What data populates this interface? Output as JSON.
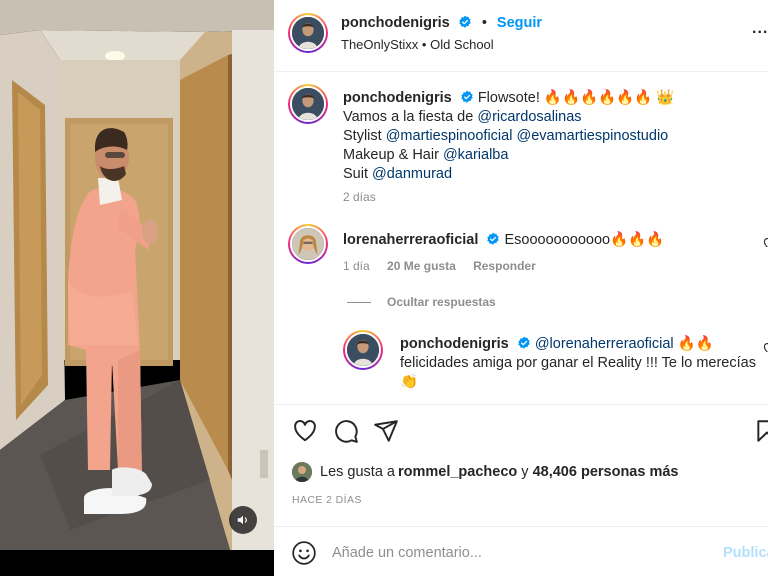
{
  "post": {
    "author": "ponchodenigris",
    "dot": "•",
    "follow_label": "Seguir",
    "audio": "TheOnlyStixx • Old School",
    "more_label": "..."
  },
  "caption": {
    "username": "ponchodenigris",
    "text": "Flowsote!",
    "emoji": "🔥🔥🔥🔥🔥🔥 👑",
    "line2_prefix": "Vamos a la fiesta de ",
    "line2_mention": "@ricardosalinas",
    "line3_prefix": "Stylist ",
    "line3_mention1": "@martiespinooficial",
    "line3_mention2": "@evamartiespinostudio",
    "line4_prefix": "Makeup & Hair ",
    "line4_mention": "@karialba",
    "line5_prefix": "Suit ",
    "line5_mention": "@danmurad",
    "time": "2 días"
  },
  "comment": {
    "username": "lorenaherreraoficial",
    "text": "Esooooooooooo",
    "emoji": "🔥🔥🔥",
    "time": "1 día",
    "likes": "20 Me gusta",
    "reply_label": "Responder"
  },
  "hide_replies_label": "Ocultar respuestas",
  "reply": {
    "username": "ponchodenigris",
    "mention": "@lorenaherreraoficial",
    "emoji": "🔥🔥",
    "line2": "felicidades amiga por ganar el Reality !!! Te lo merecías",
    "line3": "👏"
  },
  "likes": {
    "prefix": "Les gusta a ",
    "user": "rommel_pacheco",
    "middle": " y ",
    "others": "48,406 personas más"
  },
  "post_time": "HACE 2 DÍAS",
  "composer": {
    "placeholder": "Añade un comentario...",
    "publish_label": "Publicar"
  },
  "icons": {
    "verified": "verified-badge-icon",
    "like": "heart-icon",
    "comment": "comment-bubble-icon",
    "share": "paper-plane-icon",
    "save": "bookmark-icon",
    "emoji": "smiley-icon",
    "audio": "speaker-icon"
  },
  "colors": {
    "accent": "#0095f6",
    "verified": "#0095f6",
    "mention": "#00376b",
    "muted": "#8e8e8e",
    "publish_disabled": "#b2dffc"
  }
}
